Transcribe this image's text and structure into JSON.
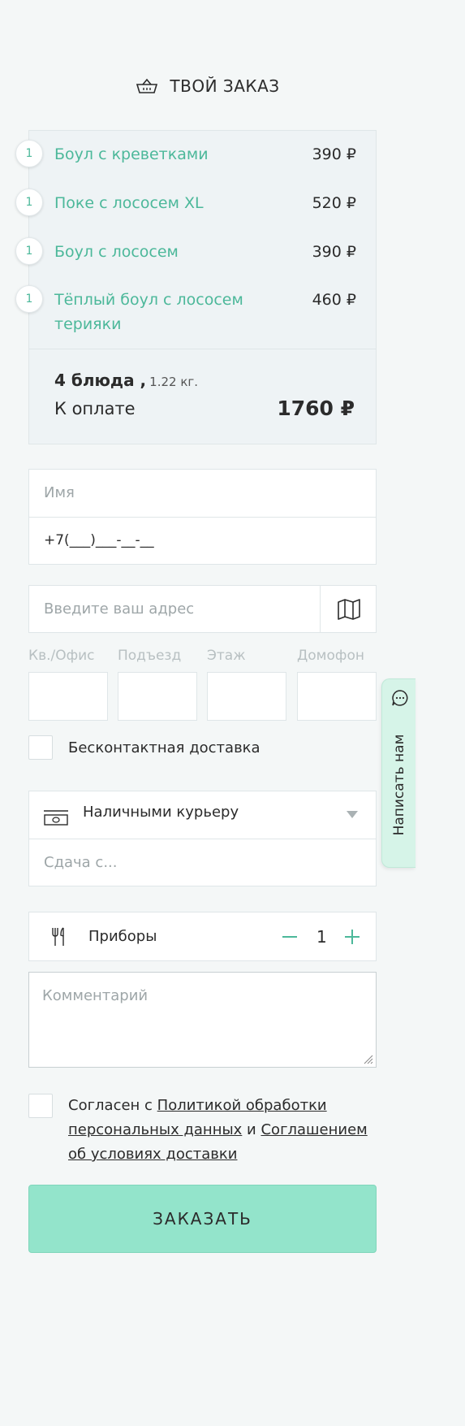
{
  "header": {
    "title": "ТВОЙ ЗАКАЗ",
    "icon": "basket-icon"
  },
  "order": {
    "items": [
      {
        "qty": "1",
        "name": "Боул с креветками",
        "price": "390 ₽"
      },
      {
        "qty": "1",
        "name": "Поке с лососем XL",
        "price": "520 ₽"
      },
      {
        "qty": "1",
        "name": "Боул с лососем",
        "price": "390 ₽"
      },
      {
        "qty": "1",
        "name": "Тёплый боул с лососем терияки",
        "price": "460 ₽"
      }
    ],
    "count": "4 блюда ,",
    "weight": "1.22 кг.",
    "pay_label": "К оплате",
    "total": "1760 ₽"
  },
  "form": {
    "name_placeholder": "Имя",
    "phone_mask": "+7(___)___-__-__",
    "address_placeholder": "Введите ваш адрес",
    "apt_label": "Кв./Офис",
    "entrance_label": "Подъезд",
    "floor_label": "Этаж",
    "intercom_label": "Домофон",
    "contactless_label": "Бесконтактная доставка",
    "payment_method": "Наличными курьеру",
    "change_placeholder": "Сдача с...",
    "cutlery_label": "Приборы",
    "cutlery_count": "1",
    "comment_placeholder": "Комментарий",
    "consent_prefix": "Согласен с ",
    "consent_link1": "Политикой обработки персональных данных",
    "consent_and": " и ",
    "consent_link2": "Соглашением об условиях доставки",
    "submit_label": "ЗАКАЗАТЬ"
  },
  "side_tab": {
    "label": "Написать нам",
    "icon": "chat-icon"
  },
  "colors": {
    "accent": "#4cb89a",
    "button": "#93e4cb",
    "background": "#f4f7f7"
  }
}
